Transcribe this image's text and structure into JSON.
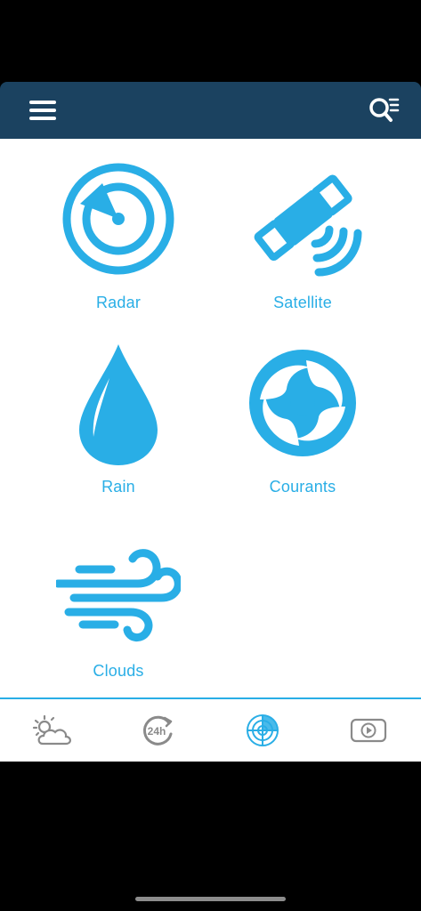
{
  "header": {
    "menu_icon": "hamburger-menu-icon",
    "search_icon": "search-list-icon",
    "background": "#1b4260"
  },
  "tiles": [
    {
      "label": "Radar",
      "icon": "radar-icon"
    },
    {
      "label": "Satellite",
      "icon": "satellite-icon"
    },
    {
      "label": "Rain",
      "icon": "raindrop-icon"
    },
    {
      "label": "Courants",
      "icon": "currents-icon"
    },
    {
      "label": "Clouds",
      "icon": "wind-icon"
    }
  ],
  "tab_bar": {
    "tabs": [
      {
        "icon": "sun-cloud-icon",
        "active": false
      },
      {
        "icon": "24h-icon",
        "active": false
      },
      {
        "icon": "radar-icon",
        "active": true
      },
      {
        "icon": "video-play-icon",
        "active": false
      }
    ]
  },
  "colors": {
    "accent": "#29aee6",
    "inactive_icon": "#8a8a8a",
    "header": "#1b4260"
  }
}
